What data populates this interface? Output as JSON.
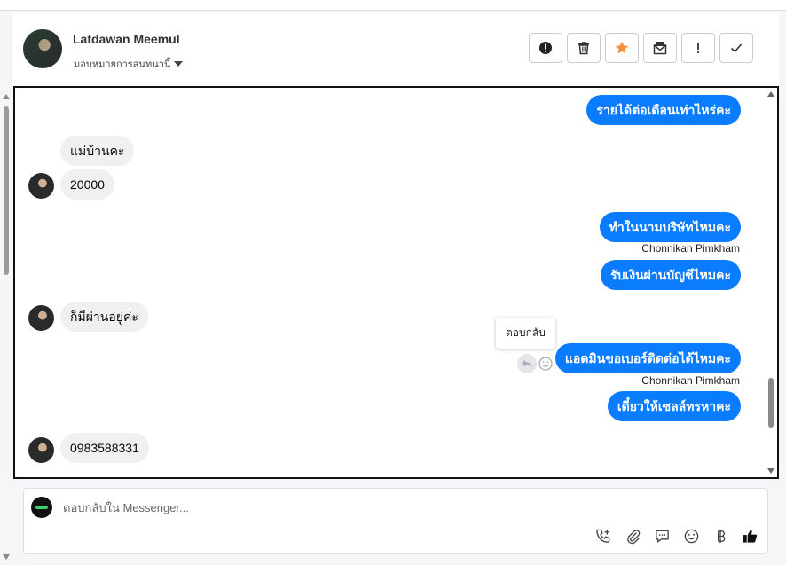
{
  "header": {
    "contact_name": "Latdawan Meemul",
    "assign_label": "มอบหมายการสนทนานี้",
    "toolbar": [
      {
        "icon": "alert-circle-icon",
        "name": "mark-spam-button"
      },
      {
        "icon": "trash-icon",
        "name": "delete-button"
      },
      {
        "icon": "star-icon",
        "name": "star-button"
      },
      {
        "icon": "mark-unread-icon",
        "name": "mark-unread-button"
      },
      {
        "icon": "exclamation-icon",
        "name": "follow-up-button"
      },
      {
        "icon": "check-icon",
        "name": "mark-done-button"
      }
    ]
  },
  "messages": [
    {
      "side": "out",
      "text": "รายได้ต่อเดือนเท่าไหร่คะ"
    },
    {
      "side": "in",
      "text": "แม่บ้านคะ"
    },
    {
      "side": "in",
      "text": "20000"
    },
    {
      "side": "out",
      "text": "ทำในนามบริษัทไหมคะ"
    },
    {
      "side": "sender",
      "text": "Chonnikan Pimkham"
    },
    {
      "side": "out",
      "text": "รับเงินผ่านบัญชีไหมคะ"
    },
    {
      "side": "in",
      "text": "ก็มีผ่านอยู่ค่ะ"
    },
    {
      "side": "out",
      "text": "แอดมินขอเบอร์ติดต่อได้ไหมคะ"
    },
    {
      "side": "sender",
      "text": "Chonnikan Pimkham"
    },
    {
      "side": "out",
      "text": "เดี๋ยวให้เซลล์ทรหาคะ"
    },
    {
      "side": "in",
      "text": "0983588331"
    }
  ],
  "tooltip": "ตอบกลับ",
  "composer": {
    "placeholder": "ตอบกลับใน Messenger...",
    "tools": [
      "phone-plus-icon",
      "paperclip-icon",
      "chat-bubble-icon",
      "smiley-icon",
      "baht-icon",
      "thumbs-up-icon"
    ]
  },
  "colors": {
    "outgoing_bubble": "#0a7cff",
    "incoming_bubble": "#f0f0f0",
    "star": "#f7923a"
  }
}
